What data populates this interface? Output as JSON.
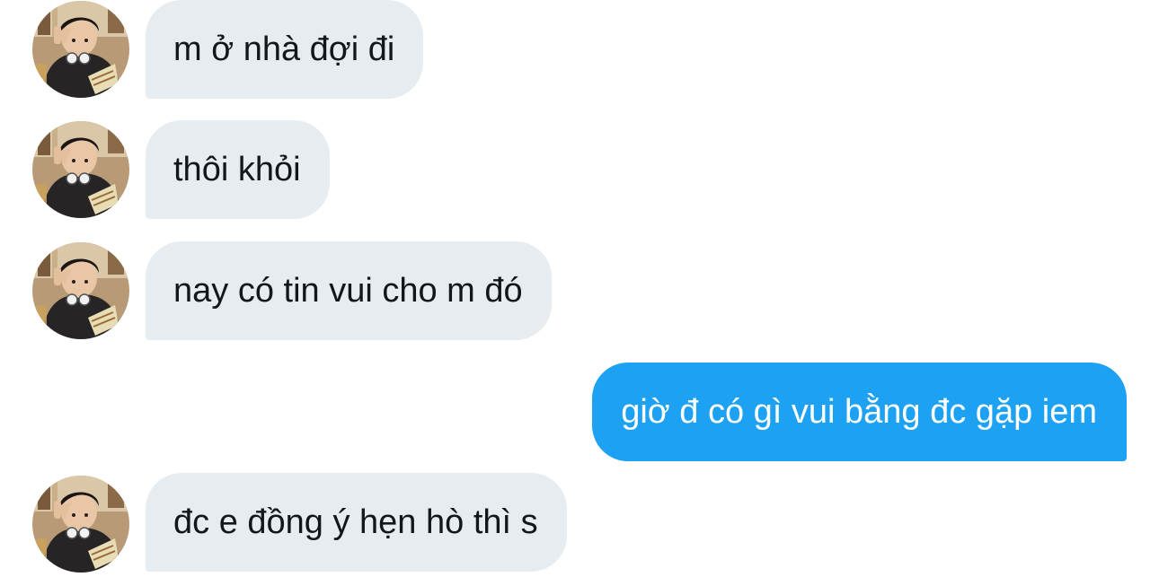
{
  "colors": {
    "incoming_bubble": "#e6ecf0",
    "outgoing_bubble": "#1da1f2",
    "incoming_text": "#14171a",
    "outgoing_text": "#ffffff"
  },
  "messages": [
    {
      "direction": "incoming",
      "text": "m ở nhà đợi đi",
      "avatar_icon": "user-avatar"
    },
    {
      "direction": "incoming",
      "text": "thôi khỏi",
      "avatar_icon": "user-avatar"
    },
    {
      "direction": "incoming",
      "text": "nay có tin vui cho m đó",
      "avatar_icon": "user-avatar"
    },
    {
      "direction": "outgoing",
      "text": "giờ đ có gì vui bằng đc gặp iem"
    },
    {
      "direction": "incoming",
      "text": "đc e đồng ý hẹn hò thì s",
      "avatar_icon": "user-avatar"
    }
  ]
}
